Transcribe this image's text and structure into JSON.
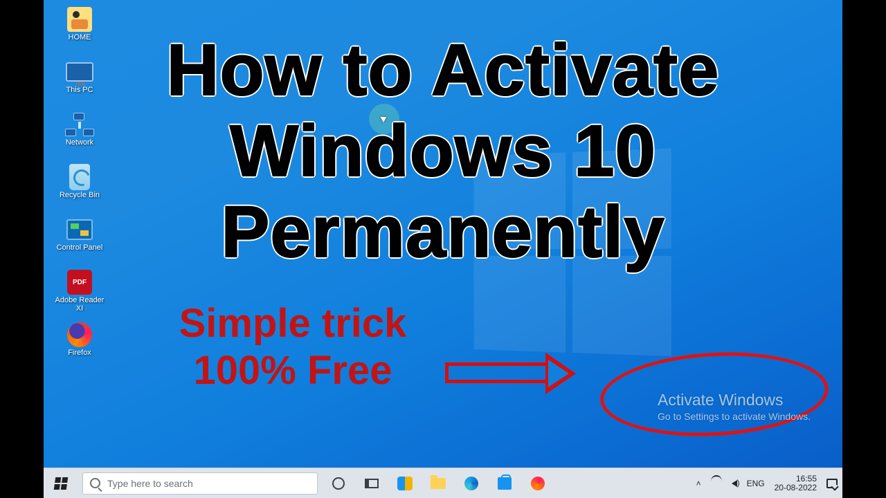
{
  "desktop_icons": [
    {
      "label": "HOME"
    },
    {
      "label": "This PC"
    },
    {
      "label": "Network"
    },
    {
      "label": "Recycle Bin"
    },
    {
      "label": "Control Panel"
    },
    {
      "label": "Adobe Reader XI"
    },
    {
      "label": "Firefox"
    }
  ],
  "overlay": {
    "line1": "How to Activate",
    "line2": "Windows 10",
    "line3": "Permanently",
    "sub1": "Simple trick",
    "sub2": "100% Free"
  },
  "watermark": {
    "title": "Activate Windows",
    "subtitle": "Go to Settings to activate Windows."
  },
  "taskbar": {
    "search_placeholder": "Type here to search",
    "tray": {
      "lang": "ENG",
      "time": "16:55",
      "date": "20-08-2022"
    }
  }
}
